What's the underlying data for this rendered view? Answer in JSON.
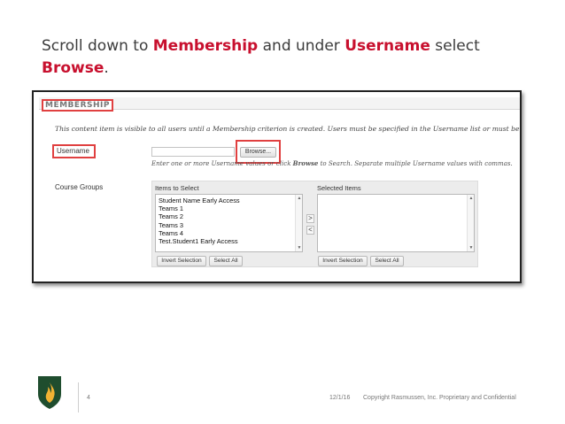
{
  "instruction": {
    "part1": "Scroll down to ",
    "membership": "Membership",
    "part2": " and under ",
    "username": "Username",
    "part3": " select",
    "browse": "Browse",
    "part4": "."
  },
  "membership": {
    "section_title": "MEMBERSHIP",
    "note": "This content item is visible to all users until a Membership criterion is created. Users must be specified in the Username list or must be in a selected Group.",
    "username_label": "Username",
    "username_value": "",
    "browse_button": "Browse...",
    "hint_before": "Enter one or more Username values or click ",
    "hint_bold": "Browse",
    "hint_after": " to Search. Separate multiple Username values with commas.",
    "course_groups_label": "Course Groups",
    "items_to_select_label": "Items to Select",
    "items_to_select": [
      "Student Name Early Access",
      "Teams 1",
      "Teams 2",
      "Teams 3",
      "Teams 4",
      "Test.Student1 Early Access"
    ],
    "selected_items_label": "Selected Items",
    "move_right": ">",
    "move_left": "<",
    "left_invert": "Invert Selection",
    "left_select_all": "Select All",
    "right_invert": "Invert Selection",
    "right_select_all": "Select All"
  },
  "footer": {
    "slide_number": "4",
    "date": "12/1/16",
    "copyright": "Copyright Rasmussen, Inc. Proprietary and Confidential"
  },
  "colors": {
    "highlight_red": "#c8102e",
    "logo_green": "#1f4d2e",
    "logo_gold": "#f2b233"
  }
}
